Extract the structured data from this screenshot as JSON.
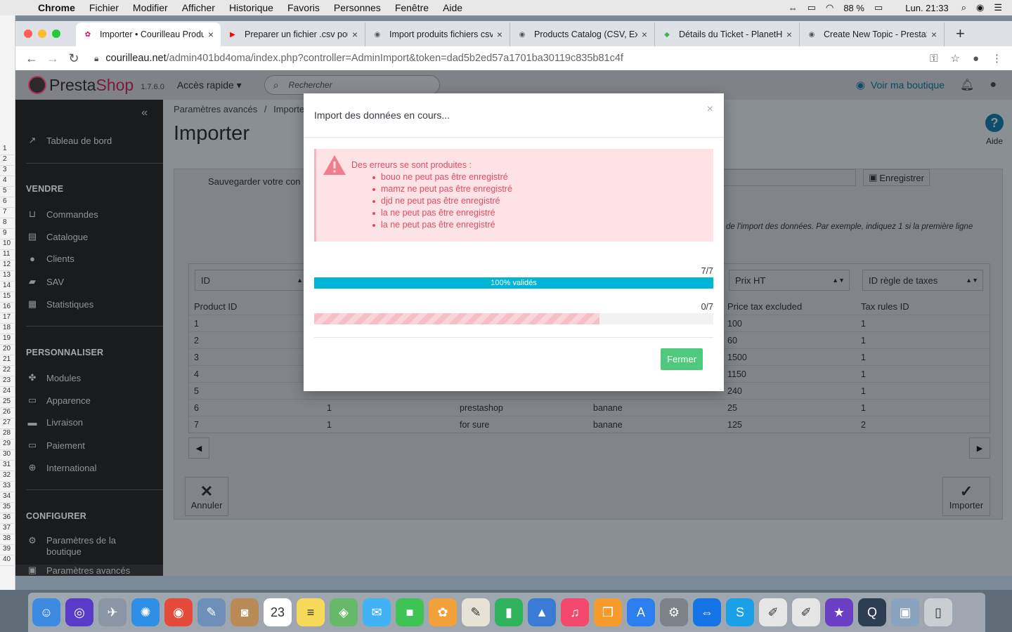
{
  "menubar": {
    "app": "Chrome",
    "items": [
      "Fichier",
      "Modifier",
      "Afficher",
      "Historique",
      "Favoris",
      "Personnes",
      "Fenêtre",
      "Aide"
    ],
    "battery": "88 %",
    "clock": "Lun. 21:33"
  },
  "sheet": {
    "rows": [
      "1",
      "2",
      "3",
      "4",
      "5",
      "6",
      "7",
      "8",
      "9",
      "10",
      "11",
      "12",
      "13",
      "14",
      "15",
      "16",
      "17",
      "18",
      "19",
      "20",
      "21",
      "22",
      "23",
      "24",
      "25",
      "26",
      "27",
      "28",
      "29",
      "30",
      "31",
      "32",
      "33",
      "34",
      "35",
      "36",
      "37",
      "38",
      "39",
      "40"
    ]
  },
  "tabs": [
    {
      "title": "Importer • Courilleau Produits",
      "fav_color": "#df0067",
      "fav": "✿"
    },
    {
      "title": "Preparer un fichier .csv pour",
      "fav_color": "#ff0000",
      "fav": "▶"
    },
    {
      "title": "Import produits fichiers csv",
      "fav_color": "#555555",
      "fav": "◉"
    },
    {
      "title": "Products Catalog (CSV, Excel)",
      "fav_color": "#555555",
      "fav": "◉"
    },
    {
      "title": "Détails du Ticket - PlanetHoster",
      "fav_color": "#4caf50",
      "fav": "◆"
    },
    {
      "title": "Create New Topic - PrestaShop",
      "fav_color": "#555555",
      "fav": "◉"
    }
  ],
  "address": {
    "host": "courilleau.net",
    "path": "/admin401bd4oma/index.php?controller=AdminImport&token=dad5b2ed57a1701ba30119c835b81c4f"
  },
  "header": {
    "brand_a": "Presta",
    "brand_b": "Shop",
    "version": "1.7.6.0",
    "quick_access": "Accès rapide ▾",
    "search_placeholder": "Rechercher",
    "view_shop": "Voir ma boutique"
  },
  "sidebar": {
    "dashboard": "Tableau de bord",
    "sections": {
      "sell": "VENDRE",
      "customize": "PERSONNALISER",
      "configure": "CONFIGURER"
    },
    "sell_items": [
      "Commandes",
      "Catalogue",
      "Clients",
      "SAV",
      "Statistiques"
    ],
    "customize_items": [
      "Modules",
      "Apparence",
      "Livraison",
      "Paiement",
      "International"
    ],
    "configure_items": [
      "Paramètres de la boutique",
      "Paramètres avancés"
    ]
  },
  "content": {
    "breadcrumb_parent": "Paramètres avancés",
    "breadcrumb_sep": "/",
    "breadcrumb_current": "Importer",
    "title": "Importer",
    "help": "Aide",
    "save_label": "Sauvegarder votre con",
    "save_button": "Enregistrer",
    "hint": "de l'import des données. Par exemple, indiquez 1 si la première ligne",
    "selects": [
      "ID",
      "Prix HT",
      "ID règle de taxes"
    ],
    "headers": [
      "Product ID",
      "Price tax excluded",
      "Tax rules ID"
    ],
    "rows": [
      {
        "id": "1",
        "c2": "",
        "c3": "",
        "c4": "",
        "price": "100",
        "tax": "1"
      },
      {
        "id": "2",
        "c2": "",
        "c3": "",
        "c4": "",
        "price": "60",
        "tax": "1"
      },
      {
        "id": "3",
        "c2": "",
        "c3": "",
        "c4": "",
        "price": "1500",
        "tax": "1"
      },
      {
        "id": "4",
        "c2": "",
        "c3": "",
        "c4": "",
        "price": "1150",
        "tax": "1"
      },
      {
        "id": "5",
        "c2": "",
        "c3": "",
        "c4": "",
        "price": "240",
        "tax": "1"
      },
      {
        "id": "6",
        "c2": "1",
        "c3": "prestashop",
        "c4": "banane",
        "price": "25",
        "tax": "1"
      },
      {
        "id": "7",
        "c2": "1",
        "c3": "for sure",
        "c4": "banane",
        "price": "125",
        "tax": "2"
      }
    ],
    "cancel": "Annuler",
    "import": "Importer"
  },
  "modal": {
    "title": "Import des données en cours...",
    "error_title": "Des erreurs se sont produites :",
    "errors": [
      "bouo ne peut pas être enregistré",
      "mamz ne peut pas être enregistré",
      "djd ne peut pas être enregistré",
      "la ne peut pas être enregistré",
      "la ne peut pas être enregistré"
    ],
    "validate_count": "7/7",
    "validate_label": "100% validés",
    "validate_fraction": 1.0,
    "import_count": "0/7",
    "import_fraction": 0.715,
    "close": "Fermer"
  },
  "dock": {
    "apps": [
      {
        "name": "finder",
        "color": "#3d8be0",
        "glyph": "☺"
      },
      {
        "name": "siri",
        "color": "#5a3ac9",
        "glyph": "◎"
      },
      {
        "name": "launchpad",
        "color": "#8a96a6",
        "glyph": "✈"
      },
      {
        "name": "safari",
        "color": "#2f8ee6",
        "glyph": "✺"
      },
      {
        "name": "chrome",
        "color": "#e44b3a",
        "glyph": "◉"
      },
      {
        "name": "preview",
        "color": "#6d8fb8",
        "glyph": "✎"
      },
      {
        "name": "contacts",
        "color": "#b88a55",
        "glyph": "◙"
      },
      {
        "name": "calendar",
        "color": "#ffffff",
        "glyph": "23"
      },
      {
        "name": "notes",
        "color": "#f7d95a",
        "glyph": "≡"
      },
      {
        "name": "maps",
        "color": "#67b96a",
        "glyph": "◈"
      },
      {
        "name": "messages",
        "color": "#3fb3f5",
        "glyph": "✉"
      },
      {
        "name": "facetime",
        "color": "#3ec455",
        "glyph": "■"
      },
      {
        "name": "photos",
        "color": "#f2a13a",
        "glyph": "✿"
      },
      {
        "name": "keynote-doc",
        "color": "#e7e2d6",
        "glyph": "✎"
      },
      {
        "name": "numbers",
        "color": "#2fb35c",
        "glyph": "▮"
      },
      {
        "name": "keynote",
        "color": "#3a7bd5",
        "glyph": "▲"
      },
      {
        "name": "music",
        "color": "#f5486f",
        "glyph": "♫"
      },
      {
        "name": "books",
        "color": "#f59a2b",
        "glyph": "❐"
      },
      {
        "name": "app-store",
        "color": "#2d7ff0",
        "glyph": "A"
      },
      {
        "name": "system-preferences",
        "color": "#7d8288",
        "glyph": "⚙"
      },
      {
        "name": "teamviewer",
        "color": "#1673e5",
        "glyph": "⇔"
      },
      {
        "name": "skype",
        "color": "#1aa0e8",
        "glyph": "S"
      },
      {
        "name": "textedit",
        "color": "#e6e6e6",
        "glyph": "✐"
      },
      {
        "name": "textedit-2",
        "color": "#e6e6e6",
        "glyph": "✐"
      },
      {
        "name": "imovie",
        "color": "#6a3fc5",
        "glyph": "★"
      },
      {
        "name": "quicktime",
        "color": "#2d3e52",
        "glyph": "Q"
      },
      {
        "name": "image-capture",
        "color": "#8aa3bd",
        "glyph": "▣"
      },
      {
        "name": "trash",
        "color": "#c9ced3",
        "glyph": "▯"
      }
    ]
  }
}
